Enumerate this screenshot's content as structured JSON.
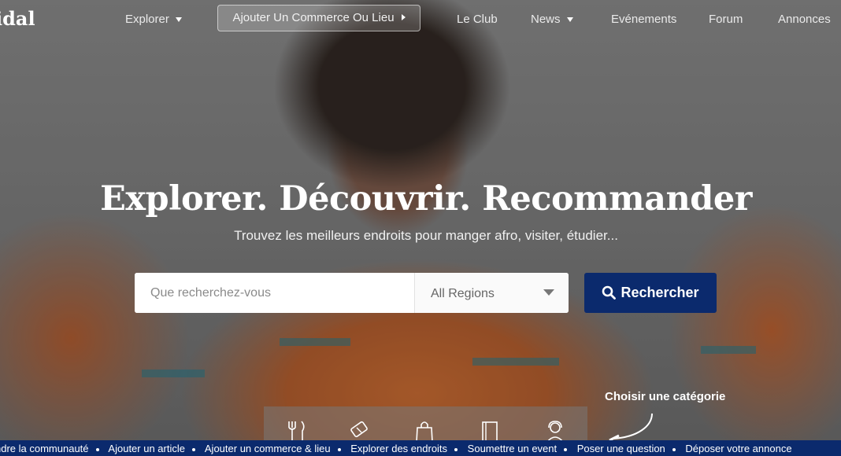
{
  "brand": {
    "logo_text": "idal"
  },
  "nav": {
    "explorer": "Explorer",
    "add_business": "Ajouter Un Commerce Ou Lieu",
    "club": "Le Club",
    "news": "News",
    "events": "Evénements",
    "forum": "Forum",
    "ads": "Annonces"
  },
  "hero": {
    "headline": "Explorer. Découvrir. Recommander",
    "subline": "Trouvez les meilleurs endroits pour manger afro, visiter, étudier..."
  },
  "search": {
    "placeholder": "Que recherchez-vous",
    "region": "All Regions",
    "button": "Rechercher"
  },
  "categories": {
    "title": "Choisir une catégorie",
    "icons": [
      "fork-knife-icon",
      "ticket-icon",
      "shopping-bag-icon",
      "book-icon",
      "support-agent-icon"
    ]
  },
  "ticker": {
    "items": [
      "ndre la communauté",
      "Ajouter un article",
      "Ajouter un commerce & lieu",
      "Explorer des endroits",
      "Soumettre un event",
      "Poser une question",
      "Déposer votre annonce"
    ]
  },
  "colors": {
    "primary": "#0b2a6d",
    "white": "#ffffff"
  }
}
